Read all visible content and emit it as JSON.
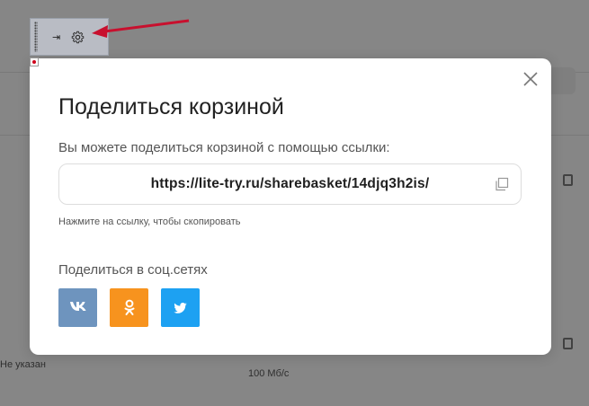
{
  "background": {
    "left_text": "Не указан",
    "bottom_text": "100 Мб/с"
  },
  "toolbar": {
    "pin_icon": "pin-icon",
    "gear_icon": "gear-icon",
    "pin_symbol": "⇥"
  },
  "modal": {
    "title": "Поделиться корзиной",
    "description": "Вы можете поделиться корзиной с помощью ссылки:",
    "link": "https://lite-try.ru/sharebasket/14djq3h2is/",
    "hint": "Нажмите на ссылку, чтобы скопировать",
    "social_title": "Поделиться в соц.сетях",
    "social": [
      {
        "name": "vk",
        "label": "VK",
        "icon": "vk-icon",
        "color": "#6e94be"
      },
      {
        "name": "ok",
        "label": "OK",
        "icon": "odnoklassniki-icon",
        "color": "#f7931e"
      },
      {
        "name": "twitter",
        "label": "Twitter",
        "icon": "twitter-icon",
        "color": "#1da1f2"
      }
    ]
  },
  "colors": {
    "annotation_arrow": "#c8102e"
  }
}
